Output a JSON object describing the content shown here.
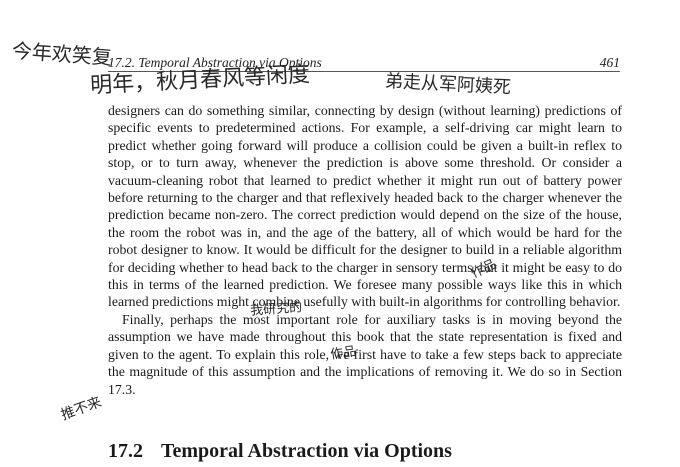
{
  "running_head": {
    "left": "17.2.  Temporal Abstraction via Options",
    "page_number": "461"
  },
  "paragraphs": [
    "designers can do something similar, connecting by design (without learning) predictions of specific events to predetermined actions. For example, a self-driving car might learn to predict whether going forward will produce a collision could be given a built-in reflex to stop, or to turn away, whenever the prediction is above some threshold. Or consider a vacuum-cleaning robot that learned to predict whether it might run out of battery power before returning to the charger and that reflexively headed back to the charger whenever the prediction became non-zero. The correct prediction would depend on the size of the house, the room the robot was in, and the age of the battery, all of which would be hard for the robot designer to know. It would be difficult for the designer to build in a reliable algorithm for deciding whether to head back to the charger in sensory terms, but it might be easy to do this in terms of the learned prediction. We foresee many possible ways like this in which learned predictions might combine usefully with built-in algorithms for controlling behavior.",
    "Finally, perhaps the most important role for auxiliary tasks is in moving beyond the assumption we have made throughout this book that the state representation is fixed and given to the agent. To explain this role, we first have to take a few steps back to appreciate the magnitude of this assumption and the implications of removing it. We do so in Section 17.3."
  ],
  "section": {
    "number": "17.2",
    "title": "Temporal Abstraction via Options"
  },
  "annotations": {
    "hw1": "今年欢笑复",
    "hw2": "明年，秋月春风等闲度",
    "hw3": "弟走从军阿姨死",
    "hw4": "我研究的",
    "hw5": "推不来",
    "hw6": "作品",
    "hw7": "作品"
  }
}
